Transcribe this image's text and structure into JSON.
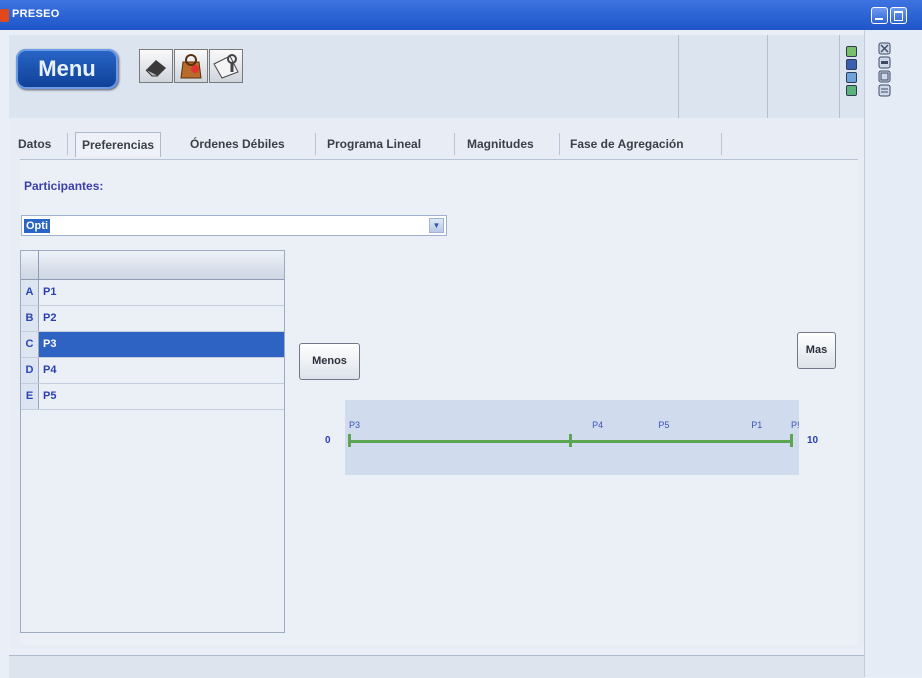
{
  "window": {
    "title": "PRESEO"
  },
  "toolbar": {
    "menu_label": "Menu",
    "icons": [
      "eraser-icon",
      "bag-icon",
      "print-preview-icon"
    ]
  },
  "tabs": [
    {
      "label": "Datos",
      "active": false
    },
    {
      "label": "Preferencias",
      "active": true
    },
    {
      "label": "Órdenes Débiles",
      "active": false
    },
    {
      "label": "Programa Lineal",
      "active": false
    },
    {
      "label": "Magnitudes",
      "active": false
    },
    {
      "label": "Fase de Agregación",
      "active": false
    }
  ],
  "participants": {
    "label": "Participantes:",
    "selected": "Opti"
  },
  "table": {
    "rows": [
      {
        "key": "A",
        "value": "P1",
        "selected": false
      },
      {
        "key": "B",
        "value": "P2",
        "selected": false
      },
      {
        "key": "C",
        "value": "P3",
        "selected": true
      },
      {
        "key": "D",
        "value": "P4",
        "selected": false
      },
      {
        "key": "E",
        "value": "P5",
        "selected": false
      }
    ]
  },
  "buttons": {
    "menos": "Menos",
    "mas": "Mas"
  },
  "scale": {
    "min": "0",
    "max": "10",
    "markers": [
      {
        "label": "P3",
        "value": 0
      },
      {
        "label": "P4",
        "value": 5.5
      },
      {
        "label": "P5",
        "value": 7.0
      },
      {
        "label": "P1",
        "value": 9.1
      },
      {
        "label": "P!",
        "value": 10
      }
    ],
    "line_color": "#5aa653"
  },
  "colors": {
    "accent": "#2f63c3",
    "title_bar": "#2a62d6"
  }
}
